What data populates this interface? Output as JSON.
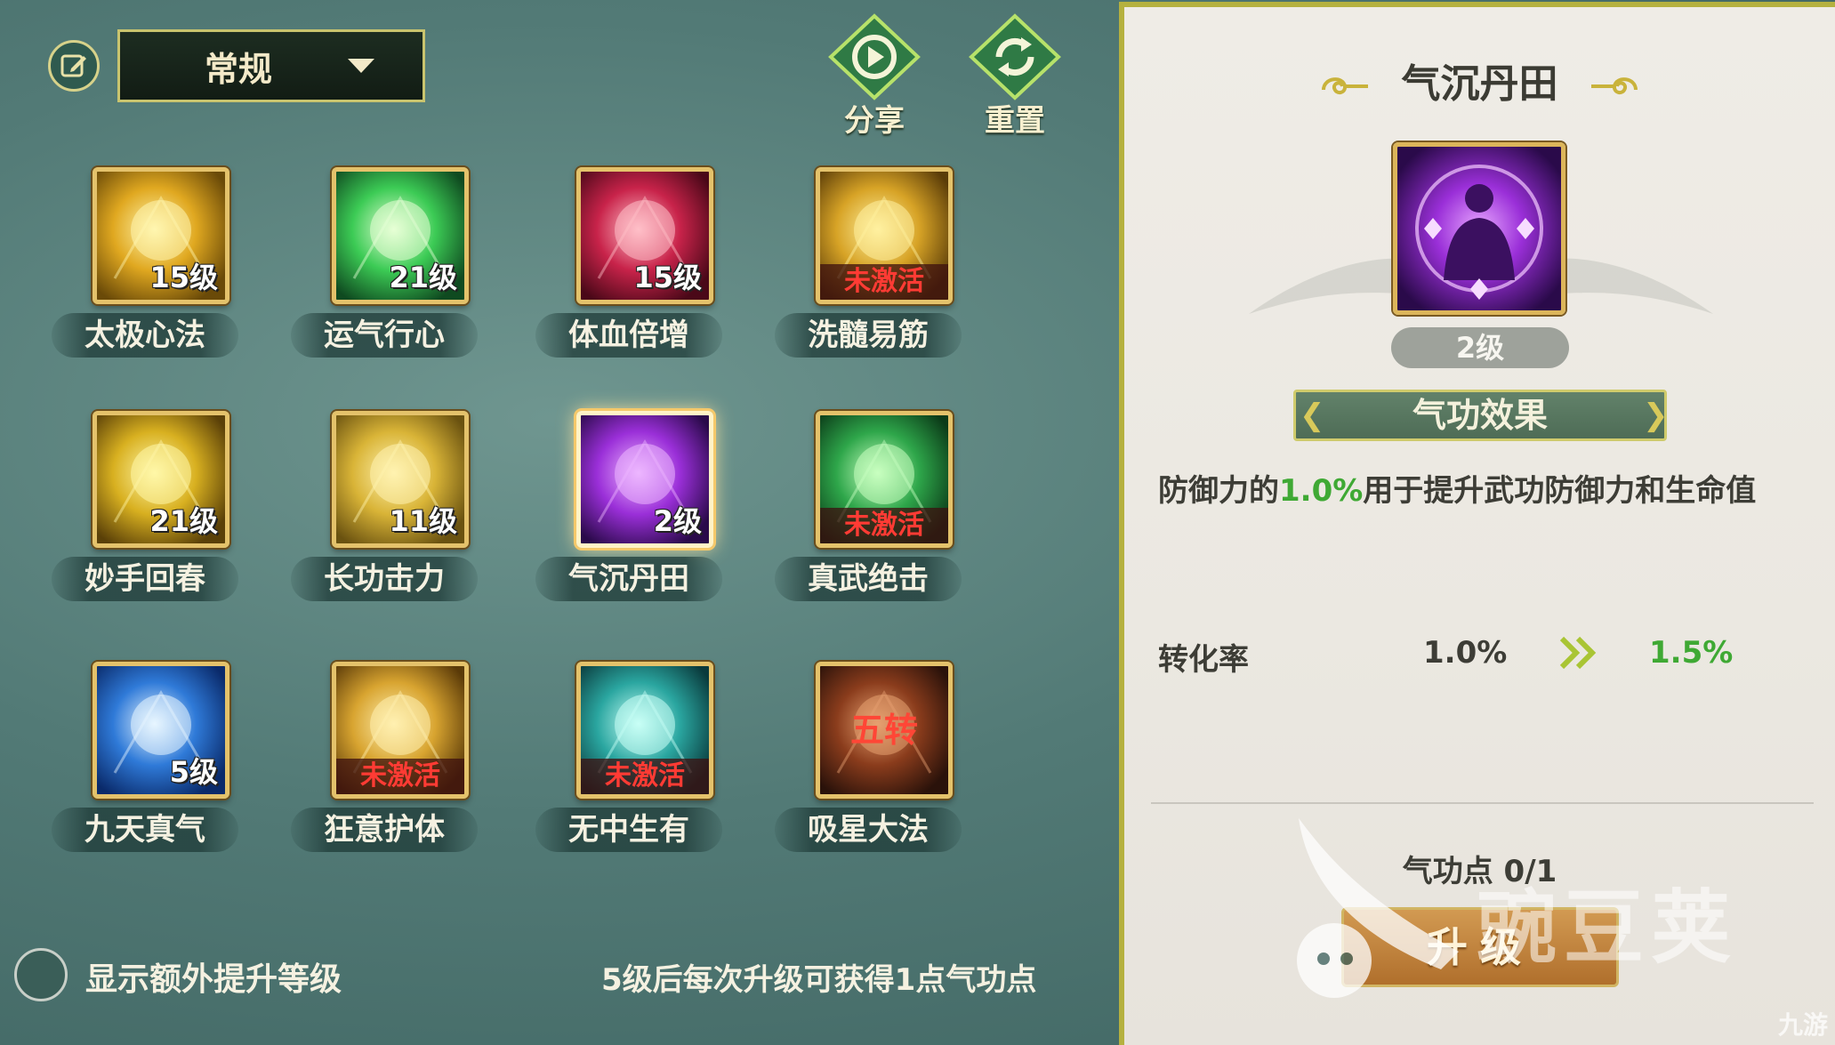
{
  "toolbar": {
    "mode_selected": "常规",
    "share_label": "分享",
    "reset_label": "重置"
  },
  "skills": [
    {
      "name": "太极心法",
      "level": "15级",
      "inactive": "",
      "theme": "gold-burst"
    },
    {
      "name": "运气行心",
      "level": "21级",
      "inactive": "",
      "theme": "green-burst"
    },
    {
      "name": "体血倍增",
      "level": "15级",
      "inactive": "",
      "theme": "red-blade"
    },
    {
      "name": "洗髓易筋",
      "level": "",
      "inactive": "未激活",
      "theme": "gold-shield"
    },
    {
      "name": "妙手回春",
      "level": "21级",
      "inactive": "",
      "theme": "gold-lightning"
    },
    {
      "name": "长功击力",
      "level": "11级",
      "inactive": "",
      "theme": "gold-swirl"
    },
    {
      "name": "气沉丹田",
      "level": "2级",
      "inactive": "",
      "theme": "purple-orb"
    },
    {
      "name": "真武绝击",
      "level": "",
      "inactive": "未激活",
      "theme": "green-muscle"
    },
    {
      "name": "九天真气",
      "level": "5级",
      "inactive": "",
      "theme": "blue-shield"
    },
    {
      "name": "狂意护体",
      "level": "",
      "inactive": "未激活",
      "theme": "gold-dome"
    },
    {
      "name": "无中生有",
      "level": "",
      "inactive": "未激活",
      "theme": "teal-shield"
    },
    {
      "name": "吸星大法",
      "level": "",
      "inactive": "五转",
      "theme": "dark-vortex"
    }
  ],
  "footer": {
    "toggle_label": "显示额外提升等级",
    "hint": "5级后每次升级可获得1点气功点"
  },
  "detail": {
    "title": "气沉丹田",
    "level": "2级",
    "effect_header": "气功效果",
    "description_prefix": "防御力的",
    "description_value": "1.0%",
    "description_suffix": "用于提升武功防御力和生命值",
    "rate_label": "转化率",
    "rate_current": "1.0%",
    "rate_next": "1.5%",
    "points": "气功点 0/1",
    "upgrade_label": "升级"
  },
  "watermark": {
    "text": "豌豆荚",
    "corner": "九游"
  },
  "colors": {
    "accent_green": "#3fa934",
    "inactive_red": "#ff3b34",
    "frame_gold": "#e4c26b",
    "panel_border": "#b5b13f"
  }
}
